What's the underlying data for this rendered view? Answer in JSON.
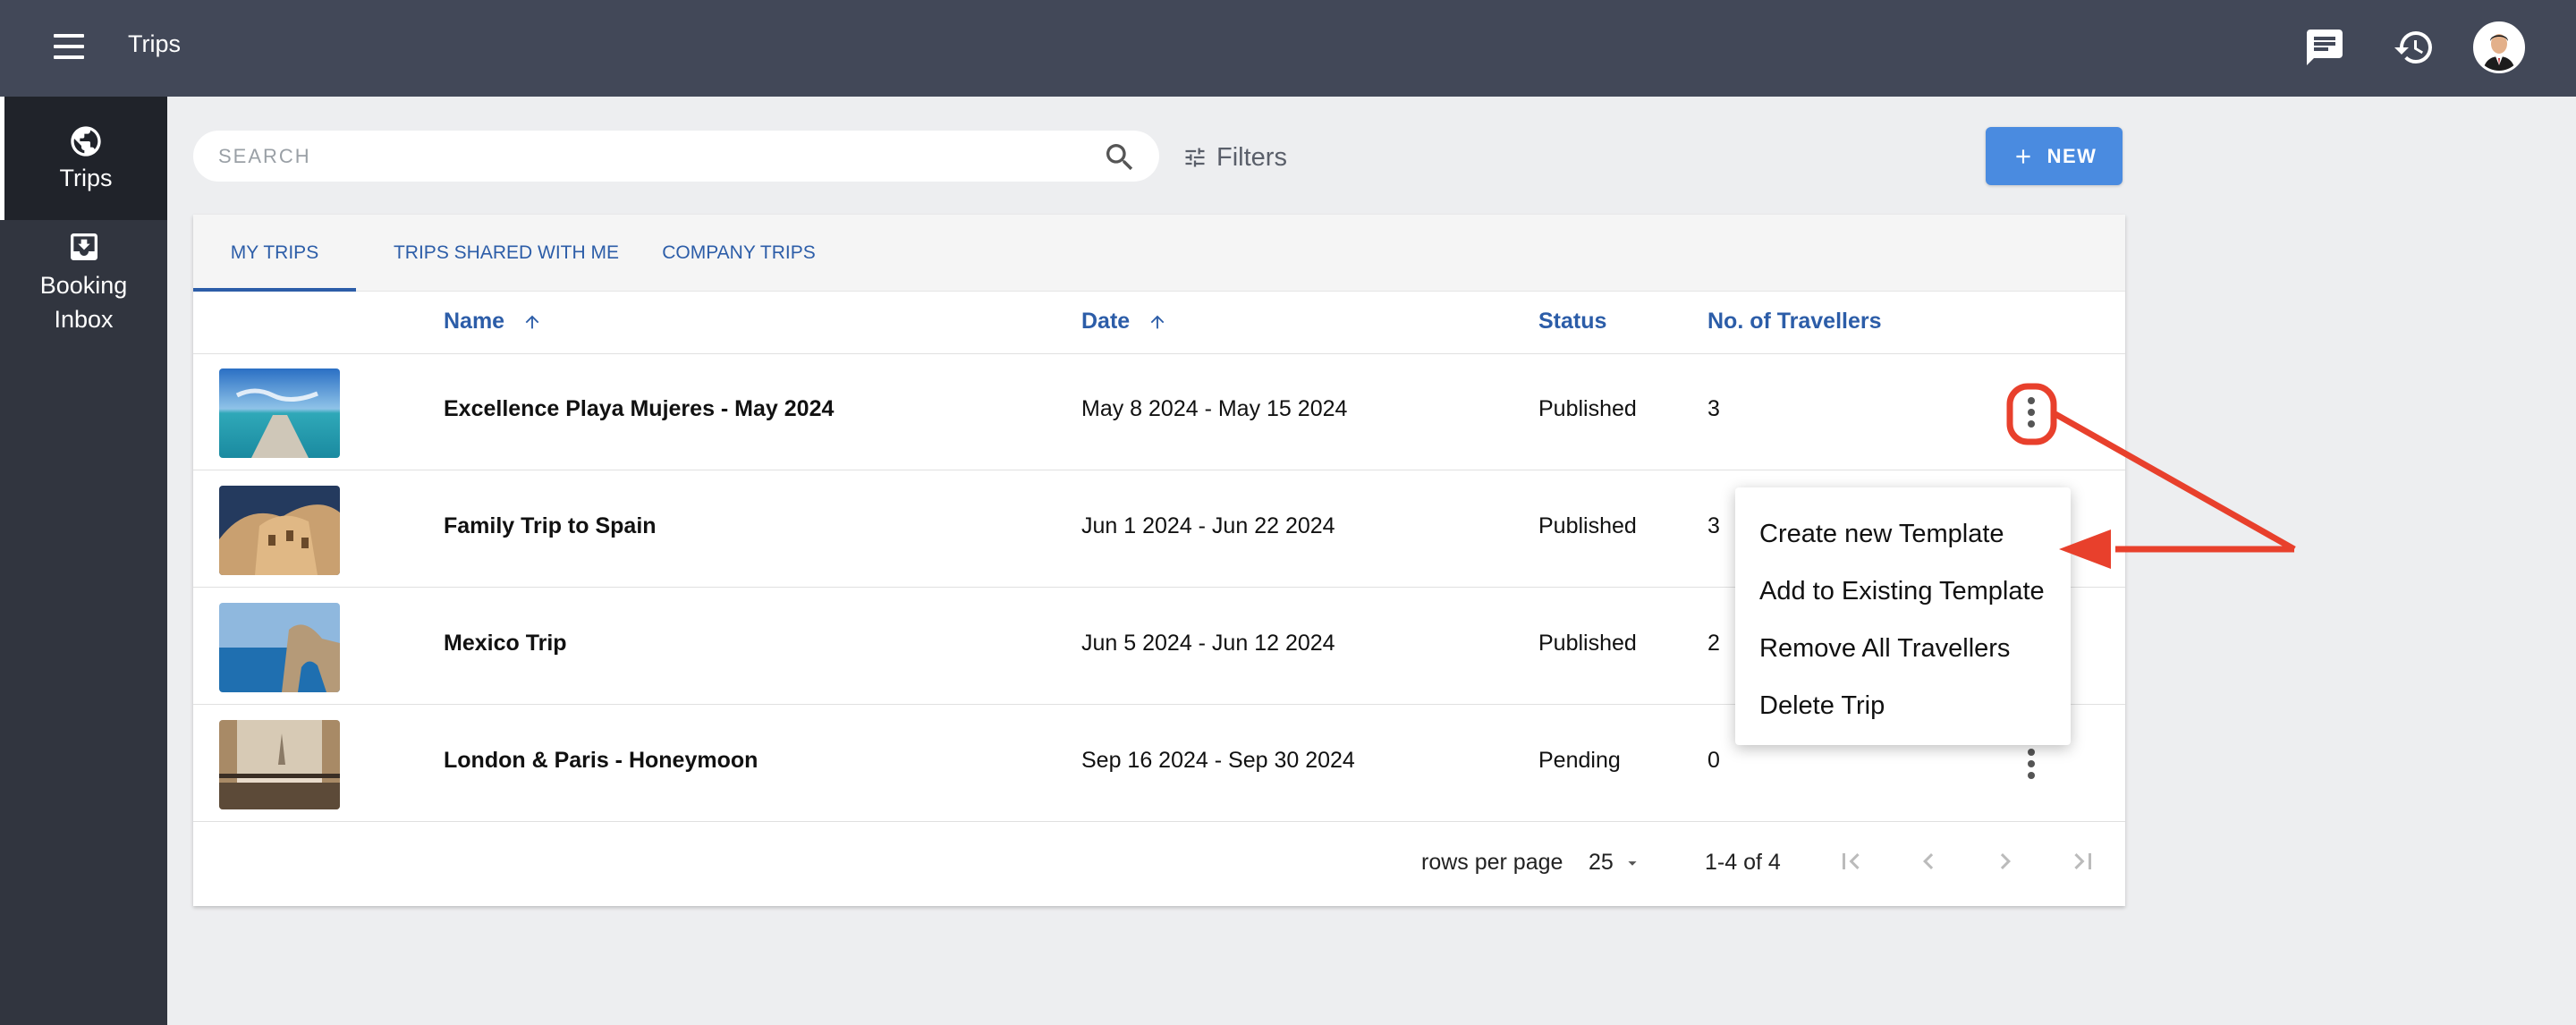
{
  "header": {
    "title": "Trips",
    "icons": [
      "menu-icon",
      "chat-icon",
      "history-icon",
      "avatar"
    ]
  },
  "sidebar": {
    "items": [
      {
        "label": "Trips",
        "icon": "globe-icon",
        "active": true
      },
      {
        "label_line1": "Booking",
        "label_line2": "Inbox",
        "icon": "inbox-icon",
        "active": false
      }
    ]
  },
  "search": {
    "placeholder": "SEARCH",
    "value": ""
  },
  "filters": {
    "label": "Filters"
  },
  "new_button": {
    "label": "NEW"
  },
  "tabs": [
    {
      "label": "MY TRIPS",
      "active": true
    },
    {
      "label": "TRIPS SHARED WITH ME",
      "active": false
    },
    {
      "label": "COMPANY TRIPS",
      "active": false
    }
  ],
  "columns": {
    "name": "Name",
    "date": "Date",
    "status": "Status",
    "travellers": "No. of Travellers"
  },
  "rows": [
    {
      "name": "Excellence Playa Mujeres - May 2024",
      "date": "May 8 2024 - May 15 2024",
      "status": "Published",
      "travellers": "3",
      "thumb": "beach-pier"
    },
    {
      "name": "Family Trip to Spain",
      "date": "Jun 1 2024 - Jun 22 2024",
      "status": "Published",
      "travellers": "3",
      "thumb": "spain-building"
    },
    {
      "name": "Mexico Trip",
      "date": "Jun 5 2024 - Jun 12 2024",
      "status": "Published",
      "travellers": "2",
      "thumb": "sea-arch"
    },
    {
      "name": "London & Paris - Honeymoon",
      "date": "Sep 16 2024 - Sep 30 2024",
      "status": "Pending",
      "travellers": "0",
      "thumb": "paris-balcony"
    }
  ],
  "pagination": {
    "rows_per_page_label": "rows per page",
    "rows_per_page": "25",
    "range": "1-4 of 4"
  },
  "context_menu": {
    "items": [
      "Create new Template",
      "Add to Existing Template",
      "Remove All Travellers",
      "Delete Trip"
    ]
  },
  "colors": {
    "topbar": "#424858",
    "sidebar": "#31353f",
    "accent": "#2c5da8",
    "button": "#4a8be0",
    "annotation": "#e8402c"
  }
}
